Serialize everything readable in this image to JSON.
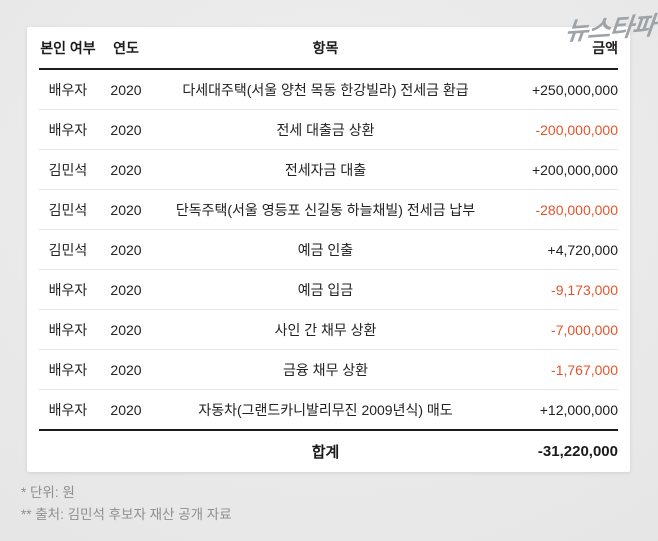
{
  "watermark": {
    "logo_text": "뉴스타파"
  },
  "table": {
    "headers": {
      "who": "본인 여부",
      "year": "연도",
      "item": "항목",
      "amount": "금액"
    },
    "rows": [
      {
        "who": "배우자",
        "year": "2020",
        "item": "다세대주택(서울 양천 목동 한강빌라) 전세금 환급",
        "amount": "+250,000,000"
      },
      {
        "who": "배우자",
        "year": "2020",
        "item": "전세 대출금 상환",
        "amount": "-200,000,000"
      },
      {
        "who": "김민석",
        "year": "2020",
        "item": "전세자금 대출",
        "amount": "+200,000,000"
      },
      {
        "who": "김민석",
        "year": "2020",
        "item": "단독주택(서울 영등포 신길동 하늘채빌) 전세금 납부",
        "amount": "-280,000,000"
      },
      {
        "who": "김민석",
        "year": "2020",
        "item": "예금 인출",
        "amount": "+4,720,000"
      },
      {
        "who": "배우자",
        "year": "2020",
        "item": "예금 입금",
        "amount": "-9,173,000"
      },
      {
        "who": "배우자",
        "year": "2020",
        "item": "사인 간 채무 상환",
        "amount": "-7,000,000"
      },
      {
        "who": "배우자",
        "year": "2020",
        "item": "금융 채무 상환",
        "amount": "-1,767,000"
      },
      {
        "who": "배우자",
        "year": "2020",
        "item": "자동차(그랜드카니발리무진 2009년식) 매도",
        "amount": "+12,000,000"
      }
    ],
    "total": {
      "label": "합계",
      "amount": "-31,220,000"
    }
  },
  "footnotes": [
    "* 단위: 원",
    "** 출처: 김민석 후보자 재산 공개 자료"
  ],
  "colors": {
    "negative_amount": "#e2552c",
    "text": "#1c1c1c",
    "background": "#e9e9e9",
    "card": "#ffffff",
    "footnote_text": "#8f8f8f",
    "divider": "#e4e4e4",
    "watermark": "#9da3a7"
  },
  "chart_data": {
    "type": "table",
    "columns": [
      "본인 여부",
      "연도",
      "항목",
      "금액"
    ],
    "rows": [
      [
        "배우자",
        "2020",
        "다세대주택(서울 양천 목동 한강빌라) 전세금 환급",
        250000000
      ],
      [
        "배우자",
        "2020",
        "전세 대출금 상환",
        -200000000
      ],
      [
        "김민석",
        "2020",
        "전세자금 대출",
        200000000
      ],
      [
        "김민석",
        "2020",
        "단독주택(서울 영등포 신길동 하늘채빌) 전세금 납부",
        -280000000
      ],
      [
        "김민석",
        "2020",
        "예금 인출",
        4720000
      ],
      [
        "배우자",
        "2020",
        "예금 입금",
        -9173000
      ],
      [
        "배우자",
        "2020",
        "사인 간 채무 상환",
        -7000000
      ],
      [
        "배우자",
        "2020",
        "금융 채무 상환",
        -1767000
      ],
      [
        "배우자",
        "2020",
        "자동차(그랜드카니발리무진 2009년식) 매도",
        12000000
      ]
    ],
    "total_row": [
      "",
      "",
      "합계",
      -31220000
    ],
    "unit": "원",
    "source": "김민석 후보자 재산 공개 자료",
    "layout_hints": {
      "negative_values_color": "#e2552c",
      "amounts_right_aligned": true
    }
  }
}
